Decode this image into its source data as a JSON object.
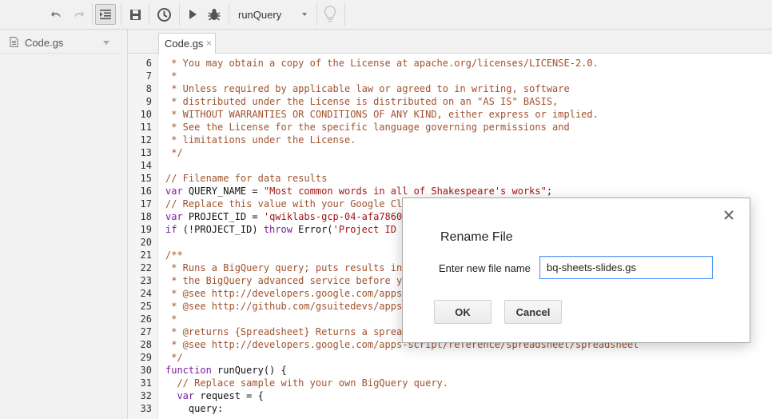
{
  "toolbar": {
    "function_select": "runQuery",
    "icons": [
      "undo-icon",
      "redo-icon",
      "indent-icon",
      "save-icon",
      "triggers-icon",
      "run-icon",
      "debug-icon",
      "lightbulb-icon"
    ]
  },
  "sidebar": {
    "files": [
      {
        "name": "Code.gs"
      }
    ]
  },
  "tabs": [
    {
      "label": "Code.gs",
      "close": "×"
    }
  ],
  "code": {
    "lines": [
      {
        "n": "6",
        "parts": [
          {
            "t": " * You may obtain a copy of the License at apache.org/licenses/LICENSE-2.0.",
            "c": "cm"
          }
        ]
      },
      {
        "n": "7",
        "parts": [
          {
            "t": " *",
            "c": "cm"
          }
        ]
      },
      {
        "n": "8",
        "parts": [
          {
            "t": " * Unless required by applicable law or agreed to in writing, software",
            "c": "cm"
          }
        ]
      },
      {
        "n": "9",
        "parts": [
          {
            "t": " * distributed under the License is distributed on an \"AS IS\" BASIS,",
            "c": "cm"
          }
        ]
      },
      {
        "n": "10",
        "parts": [
          {
            "t": " * WITHOUT WARRANTIES OR CONDITIONS OF ANY KIND, either express or implied.",
            "c": "cm"
          }
        ]
      },
      {
        "n": "11",
        "parts": [
          {
            "t": " * See the License for the specific language governing permissions and",
            "c": "cm"
          }
        ]
      },
      {
        "n": "12",
        "parts": [
          {
            "t": " * limitations under the License.",
            "c": "cm"
          }
        ]
      },
      {
        "n": "13",
        "parts": [
          {
            "t": " */",
            "c": "cm"
          }
        ]
      },
      {
        "n": "14",
        "parts": []
      },
      {
        "n": "15",
        "parts": [
          {
            "t": "// Filename for data results",
            "c": "cm"
          }
        ]
      },
      {
        "n": "16",
        "parts": [
          {
            "t": "var",
            "c": "kw"
          },
          {
            "t": " QUERY_NAME = ",
            "c": "pl"
          },
          {
            "t": "\"Most common words in all of Shakespeare's works\"",
            "c": "str"
          },
          {
            "t": ";",
            "c": "pl"
          }
        ]
      },
      {
        "n": "17",
        "parts": [
          {
            "t": "// Replace this value with your Google Cl",
            "c": "cm"
          }
        ]
      },
      {
        "n": "18",
        "parts": [
          {
            "t": "var",
            "c": "kw"
          },
          {
            "t": " PROJECT_ID = ",
            "c": "pl"
          },
          {
            "t": "'qwiklabs-gcp-04-afa7860",
            "c": "str"
          }
        ]
      },
      {
        "n": "19",
        "parts": [
          {
            "t": "if",
            "c": "kw"
          },
          {
            "t": " (!PROJECT_ID) ",
            "c": "pl"
          },
          {
            "t": "throw",
            "c": "kw"
          },
          {
            "t": " Error(",
            "c": "pl"
          },
          {
            "t": "'Project ID",
            "c": "str"
          }
        ]
      },
      {
        "n": "20",
        "parts": []
      },
      {
        "n": "21",
        "parts": [
          {
            "t": "/**",
            "c": "cm"
          }
        ]
      },
      {
        "n": "22",
        "parts": [
          {
            "t": " * Runs a BigQuery query; puts results in",
            "c": "cm"
          }
        ]
      },
      {
        "n": "23",
        "parts": [
          {
            "t": " * the BigQuery advanced service before y",
            "c": "cm"
          }
        ]
      },
      {
        "n": "24",
        "parts": [
          {
            "t": " * @see http://developers.google.com/apps",
            "c": "cm"
          }
        ]
      },
      {
        "n": "25",
        "parts": [
          {
            "t": " * @see http://github.com/gsuitedevs/apps",
            "c": "cm"
          }
        ]
      },
      {
        "n": "26",
        "parts": [
          {
            "t": " *",
            "c": "cm"
          }
        ]
      },
      {
        "n": "27",
        "parts": [
          {
            "t": " * @returns {Spreadsheet} Returns a sprea",
            "c": "cm"
          }
        ]
      },
      {
        "n": "28",
        "parts": [
          {
            "t": " * @see http://developers.google.com/apps-script/reference/spreadsheet/spreadsheet",
            "c": "cm"
          }
        ]
      },
      {
        "n": "29",
        "parts": [
          {
            "t": " */",
            "c": "cm"
          }
        ]
      },
      {
        "n": "30",
        "parts": [
          {
            "t": "function",
            "c": "kw"
          },
          {
            "t": " runQuery() {",
            "c": "pl"
          }
        ]
      },
      {
        "n": "31",
        "parts": [
          {
            "t": "  // Replace sample with your own BigQuery query.",
            "c": "cm"
          }
        ]
      },
      {
        "n": "32",
        "parts": [
          {
            "t": "  ",
            "c": "pl"
          },
          {
            "t": "var",
            "c": "kw"
          },
          {
            "t": " request = {",
            "c": "pl"
          }
        ]
      },
      {
        "n": "33",
        "parts": [
          {
            "t": "    query:",
            "c": "pl"
          }
        ]
      }
    ]
  },
  "dialog": {
    "title": "Rename File",
    "label": "Enter new file name",
    "input_value": "bq-sheets-slides.gs",
    "ok_label": "OK",
    "cancel_label": "Cancel"
  }
}
